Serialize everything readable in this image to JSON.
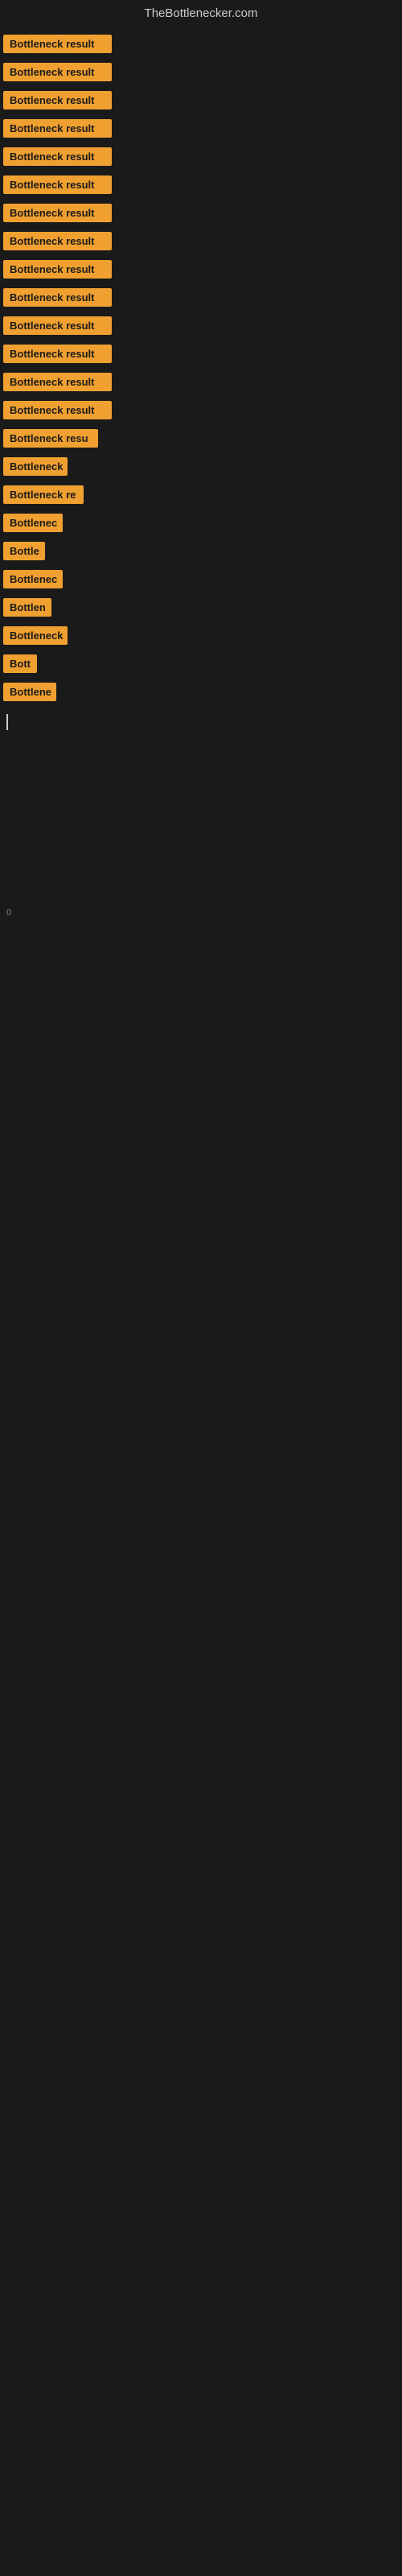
{
  "header": {
    "title": "TheBottlenecker.com"
  },
  "items": [
    {
      "label": "Bottleneck result",
      "width": 135
    },
    {
      "label": "Bottleneck result",
      "width": 135
    },
    {
      "label": "Bottleneck result",
      "width": 135
    },
    {
      "label": "Bottleneck result",
      "width": 135
    },
    {
      "label": "Bottleneck result",
      "width": 135
    },
    {
      "label": "Bottleneck result",
      "width": 135
    },
    {
      "label": "Bottleneck result",
      "width": 135
    },
    {
      "label": "Bottleneck result",
      "width": 135
    },
    {
      "label": "Bottleneck result",
      "width": 135
    },
    {
      "label": "Bottleneck result",
      "width": 135
    },
    {
      "label": "Bottleneck result",
      "width": 135
    },
    {
      "label": "Bottleneck result",
      "width": 135
    },
    {
      "label": "Bottleneck result",
      "width": 135
    },
    {
      "label": "Bottleneck result",
      "width": 135
    },
    {
      "label": "Bottleneck resu",
      "width": 118
    },
    {
      "label": "Bottleneck",
      "width": 80
    },
    {
      "label": "Bottleneck re",
      "width": 100
    },
    {
      "label": "Bottlenec",
      "width": 74
    },
    {
      "label": "Bottle",
      "width": 52
    },
    {
      "label": "Bottlenec",
      "width": 74
    },
    {
      "label": "Bottlen",
      "width": 60
    },
    {
      "label": "Bottleneck",
      "width": 80
    },
    {
      "label": "Bott",
      "width": 42
    },
    {
      "label": "Bottlene",
      "width": 66
    }
  ],
  "cursor": true,
  "footer_char": "0"
}
